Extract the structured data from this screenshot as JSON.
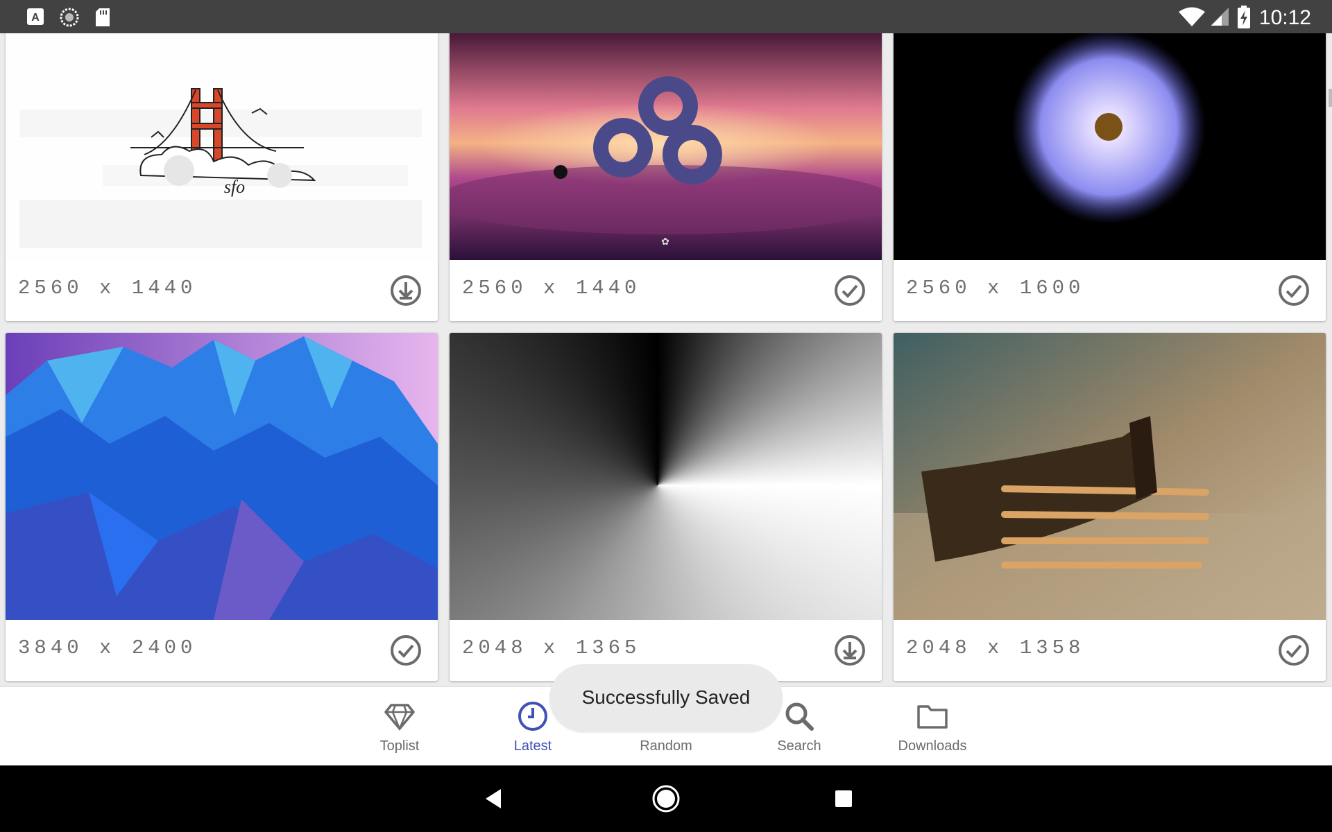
{
  "status_bar": {
    "time": "10:12",
    "left_icons": [
      "keyboard-a-icon",
      "sync-circle-icon",
      "sd-card-icon"
    ],
    "right_icons": [
      "wifi-icon",
      "cell-signal-icon",
      "battery-charging-icon"
    ]
  },
  "wallpapers": [
    {
      "resolution": "2560 x 1440",
      "action": "download",
      "thumbnail": "golden-gate-sfo-sketch"
    },
    {
      "resolution": "2560 x 1440",
      "action": "saved",
      "thumbnail": "purple-clouds-logo"
    },
    {
      "resolution": "2560 x 1600",
      "action": "saved",
      "thumbnail": "dandelion-on-black"
    },
    {
      "resolution": "3840 x 2400",
      "action": "saved",
      "thumbnail": "blue-low-poly-mountains"
    },
    {
      "resolution": "2048 x 1365",
      "action": "download",
      "thumbnail": "grayscale-conic-gradient"
    },
    {
      "resolution": "2048 x 1358",
      "action": "saved",
      "thumbnail": "fork-closeup"
    }
  ],
  "bottom_nav": {
    "items": [
      {
        "label": "Toplist",
        "icon": "diamond-icon",
        "active": false
      },
      {
        "label": "Latest",
        "icon": "clock-icon",
        "active": true
      },
      {
        "label": "Random",
        "icon": "shuffle-icon",
        "active": false
      },
      {
        "label": "Search",
        "icon": "search-icon",
        "active": false
      },
      {
        "label": "Downloads",
        "icon": "folder-icon",
        "active": false
      }
    ]
  },
  "toast": {
    "message": "Successfully Saved"
  },
  "colors": {
    "accent": "#3f51b5",
    "status_bar": "#424242",
    "icon_gray": "#6b6b6b",
    "resolution_text": "#6f6f6f"
  }
}
